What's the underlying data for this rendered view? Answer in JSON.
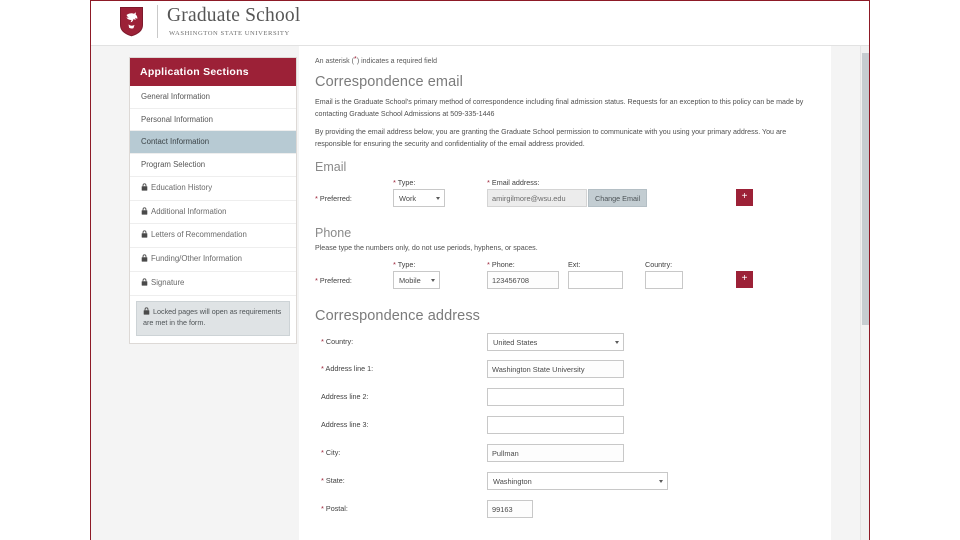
{
  "header": {
    "brand_title": "Graduate School",
    "brand_subtitle": "WASHINGTON STATE UNIVERSITY",
    "logo_icon": "wsu-cougar-shield-icon"
  },
  "sidebar": {
    "title": "Application Sections",
    "items": [
      {
        "label": "General Information",
        "locked": false,
        "active": false
      },
      {
        "label": "Personal Information",
        "locked": false,
        "active": false
      },
      {
        "label": "Contact Information",
        "locked": false,
        "active": true
      },
      {
        "label": "Program Selection",
        "locked": false,
        "active": false
      },
      {
        "label": "Education History",
        "locked": true,
        "active": false
      },
      {
        "label": "Additional Information",
        "locked": true,
        "active": false
      },
      {
        "label": "Letters of Recommendation",
        "locked": true,
        "active": false
      },
      {
        "label": "Funding/Other Information",
        "locked": true,
        "active": false
      },
      {
        "label": "Signature",
        "locked": true,
        "active": false
      }
    ],
    "locked_note": "Locked pages will open as requirements are met in the form."
  },
  "main": {
    "required_note_prefix": "An asterisk (",
    "required_note_asterisk": "*",
    "required_note_suffix": ") indicates a required field",
    "email_section": {
      "title": "Correspondence email",
      "paragraph_1": "Email is the Graduate School's primary method of correspondence including final admission status. Requests for an exception to this policy can be made by contacting Graduate School Admissions at 509-335-1446",
      "paragraph_2": "By providing the email address below, you are granting the Graduate School permission to communicate with you using your primary address. You are responsible for ensuring the security and confidentiality of the email address provided.",
      "subtitle": "Email",
      "preferred_label": "Preferred:",
      "type_label": "Type:",
      "type_value": "Work",
      "address_label": "Email address:",
      "address_value": "amirgilmore@wsu.edu",
      "change_button": "Change Email",
      "add_button": "+"
    },
    "phone_section": {
      "subtitle": "Phone",
      "hint": "Please type the numbers only, do not use periods, hyphens, or spaces.",
      "preferred_label": "Preferred:",
      "type_label": "Type:",
      "type_value": "Mobile",
      "phone_label": "Phone:",
      "phone_value": "123456708",
      "ext_label": "Ext:",
      "ext_value": "",
      "country_label": "Country:",
      "country_value": "",
      "add_button": "+"
    },
    "address_section": {
      "title": "Correspondence address",
      "country_label": "Country:",
      "country_value": "United States",
      "address1_label": "Address line 1:",
      "address1_value": "Washington State University",
      "address2_label": "Address line 2:",
      "address2_value": "",
      "address3_label": "Address line 3:",
      "address3_value": "",
      "city_label": "City:",
      "city_value": "Pullman",
      "state_label": "State:",
      "state_value": "Washington",
      "postal_label": "Postal:",
      "postal_value": "99163"
    }
  },
  "colors": {
    "crimson": "#9c2137",
    "border_crimson": "#8d1a26",
    "active_nav": "#b7cad3",
    "gray_button": "#c3cdd2"
  }
}
